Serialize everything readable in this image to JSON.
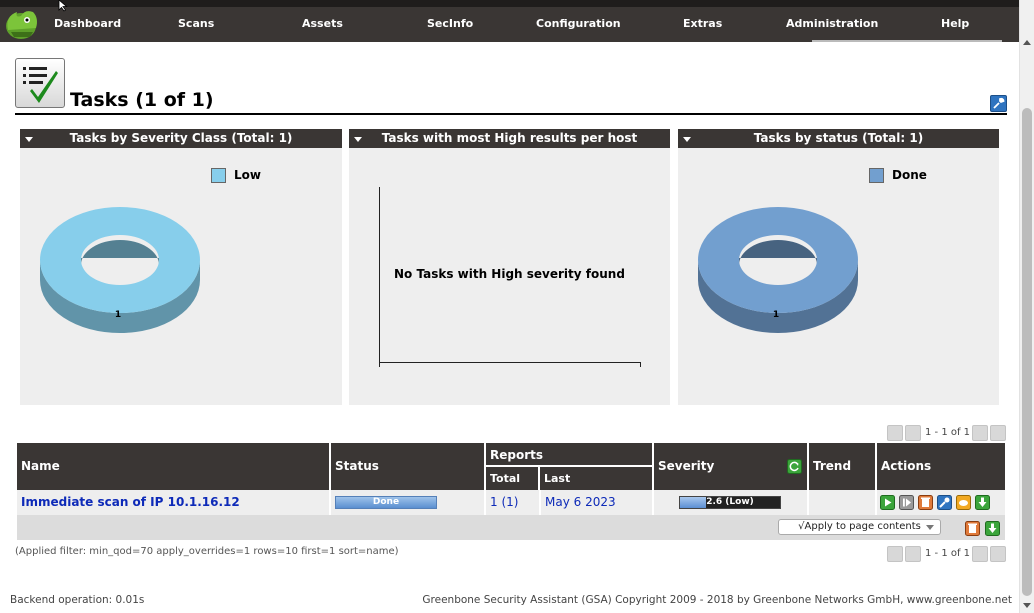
{
  "nav": {
    "items": [
      "Dashboard",
      "Scans",
      "Assets",
      "SecInfo",
      "Configuration",
      "Extras",
      "Administration",
      "Help"
    ]
  },
  "page": {
    "title": "Tasks (1 of 1)"
  },
  "panels": {
    "severity": {
      "title": "Tasks by Severity Class (Total: 1)",
      "legend": "Low",
      "legend_color": "#87ceeb",
      "slice_label": "1"
    },
    "high_results": {
      "title": "Tasks with most High results per host",
      "message": "No Tasks with High severity found"
    },
    "status": {
      "title": "Tasks by status (Total: 1)",
      "legend": "Done",
      "legend_color": "#729fcf",
      "slice_label": "1"
    }
  },
  "pagination": {
    "top": "1 - 1 of 1",
    "bottom": "1 - 1 of 1"
  },
  "table": {
    "headers": {
      "name": "Name",
      "status": "Status",
      "reports": "Reports",
      "total": "Total",
      "last": "Last",
      "severity": "Severity",
      "trend": "Trend",
      "actions": "Actions"
    },
    "rows": [
      {
        "name": "Immediate scan of IP 10.1.16.12",
        "status": "Done",
        "reports_total": "1 (1)",
        "last_report": "May 6 2023",
        "severity": "2.6 (Low)",
        "severity_value": 2.6,
        "severity_max": 10
      }
    ],
    "apply_select": "√Apply to page contents"
  },
  "filter_text": "(Applied filter: min_qod=70 apply_overrides=1 rows=10 first=1 sort=name)",
  "footer": {
    "backend": "Backend operation: 0.01s",
    "copyright": "Greenbone Security Assistant (GSA) Copyright 2009 - 2018 by Greenbone Networks GmbH, www.greenbone.net"
  },
  "colors": {
    "header_bg": "#3a3634",
    "link": "#0d2ab8",
    "low_severity": "#87ceeb",
    "done_status": "#729fcf"
  }
}
